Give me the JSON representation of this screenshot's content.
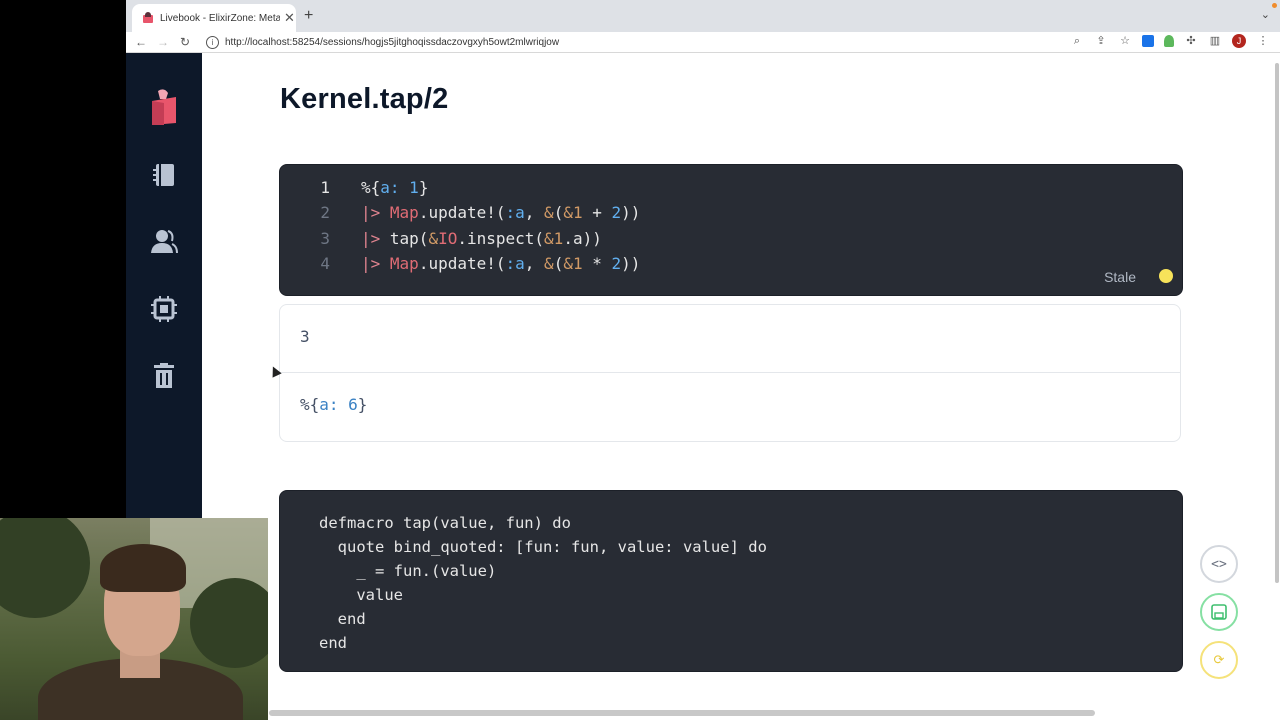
{
  "browser": {
    "tab_title": "Livebook - ElixirZone: Metapro",
    "tab_close": "✕",
    "new_tab": "+",
    "url": "http://localhost:58254/sessions/hogjs5jitghoqissdaczovgxyh5owt2mlwriqjow",
    "profile_initial": "J"
  },
  "page": {
    "title": "Kernel.tap/2"
  },
  "cell1": {
    "lines": [
      {
        "num": "1",
        "segments": [
          {
            "t": "%{",
            "c": ""
          },
          {
            "t": "a:",
            "c": "k-atom"
          },
          {
            "t": " ",
            "c": ""
          },
          {
            "t": "1",
            "c": "k-num"
          },
          {
            "t": "}",
            "c": ""
          }
        ]
      },
      {
        "num": "2",
        "segments": [
          {
            "t": "|> ",
            "c": "k-pipe"
          },
          {
            "t": "Map",
            "c": "k-mod"
          },
          {
            "t": ".update!(",
            "c": ""
          },
          {
            "t": ":a",
            "c": "k-atom"
          },
          {
            "t": ", ",
            "c": ""
          },
          {
            "t": "&",
            "c": "k-amp"
          },
          {
            "t": "(",
            "c": ""
          },
          {
            "t": "&1",
            "c": "k-amp"
          },
          {
            "t": " + ",
            "c": ""
          },
          {
            "t": "2",
            "c": "k-num"
          },
          {
            "t": "))",
            "c": ""
          }
        ]
      },
      {
        "num": "3",
        "segments": [
          {
            "t": "|> ",
            "c": "k-pipe"
          },
          {
            "t": "tap(",
            "c": ""
          },
          {
            "t": "&",
            "c": "k-amp"
          },
          {
            "t": "IO",
            "c": "k-mod"
          },
          {
            "t": ".inspect(",
            "c": ""
          },
          {
            "t": "&1",
            "c": "k-amp"
          },
          {
            "t": ".a))",
            "c": ""
          }
        ]
      },
      {
        "num": "4",
        "segments": [
          {
            "t": "|> ",
            "c": "k-pipe"
          },
          {
            "t": "Map",
            "c": "k-mod"
          },
          {
            "t": ".update!(",
            "c": ""
          },
          {
            "t": ":a",
            "c": "k-atom"
          },
          {
            "t": ", ",
            "c": ""
          },
          {
            "t": "&",
            "c": "k-amp"
          },
          {
            "t": "(",
            "c": ""
          },
          {
            "t": "&1",
            "c": "k-amp"
          },
          {
            "t": " * ",
            "c": ""
          },
          {
            "t": "2",
            "c": "k-num"
          },
          {
            "t": "))",
            "c": ""
          }
        ]
      }
    ],
    "status": "Stale",
    "status_color": "#f7e35a"
  },
  "output": {
    "stdout": "3",
    "result_prefix": "%{",
    "result_key": "a:",
    "result_value": " 6",
    "result_suffix": "}"
  },
  "cell2": {
    "code": "defmacro tap(value, fun) do\n  quote bind_quoted: [fun: fun, value: value] do\n    _ = fun.(value)\n    value\n  end\nend"
  },
  "fabs": {
    "code": "<>",
    "save": "💾",
    "reevaluate": "⟳"
  }
}
